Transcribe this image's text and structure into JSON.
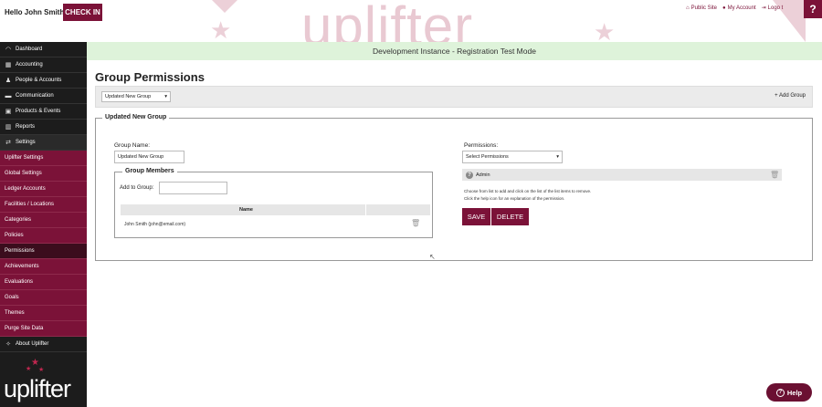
{
  "header": {
    "greeting": "Hello John Smith",
    "checkin_label": "CHECK IN",
    "links": [
      {
        "icon": "home-icon",
        "label": "Public Site"
      },
      {
        "icon": "user-icon",
        "label": "My Account"
      },
      {
        "icon": "logout-icon",
        "label": "Logo t"
      }
    ],
    "question": "?"
  },
  "sidebar": {
    "items": [
      {
        "icon": "dashboard-icon",
        "label": "Dashboard",
        "glyph": "◠"
      },
      {
        "icon": "accounting-icon",
        "label": "Accounting",
        "glyph": "▦"
      },
      {
        "icon": "people-icon",
        "label": "People & Accounts",
        "glyph": "👥"
      },
      {
        "icon": "communication-icon",
        "label": "Communication",
        "glyph": "▬"
      },
      {
        "icon": "products-icon",
        "label": "Products & Events",
        "glyph": "▣"
      },
      {
        "icon": "reports-icon",
        "label": "Reports",
        "glyph": "▥"
      },
      {
        "icon": "settings-icon",
        "label": "Settings",
        "glyph": "⇄"
      }
    ],
    "sub_items": [
      "Uplifter Settings",
      "Global Settings",
      "Ledger Accounts",
      "Facilities / Locations",
      "Categories",
      "Policies",
      "Permissions",
      "Achievements",
      "Evaluations",
      "Goals",
      "Themes",
      "Purge Site Data"
    ],
    "about_label": "About Uplifter",
    "logo_text": "uplifter"
  },
  "dev_banner": "Development Instance - Registration Test Mode",
  "page_title": "Group Permissions",
  "group_select": {
    "value": "Updated New Group"
  },
  "add_group_label": "+ Add Group",
  "group_fieldset": {
    "legend": "Updated New Group",
    "group_name_label": "Group Name:",
    "group_name_value": "Updated New Group",
    "members": {
      "legend": "Group Members",
      "add_label": "Add to Group:",
      "add_value": "",
      "column_name": "Name",
      "rows": [
        "John Smith (john@email.com)"
      ]
    },
    "permissions_label": "Permissions:",
    "permissions_select": "Select Permissions",
    "assigned": [
      "Admin"
    ],
    "help_line1": "Choose from list to add and click on the list of the list items to remove.",
    "help_line2": "Click the help icon for an explanation of the permission.",
    "save_label": "SAVE",
    "delete_label": "DELETE"
  },
  "help_button": "Help",
  "colors": {
    "brand": "#7b1238",
    "dev_banner": "#def3da"
  }
}
